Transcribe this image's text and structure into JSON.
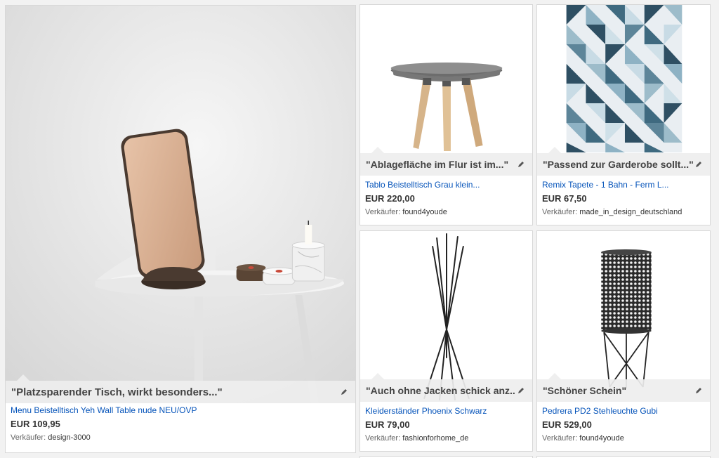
{
  "seller_label": "Verkäufer:",
  "items": [
    {
      "quote": "\"Platzsparender Tisch, wirkt besonders...\"",
      "title": "Menu Beistelltisch Yeh Wall Table nude NEU/OVP",
      "price": "EUR 109,95",
      "seller": "design-3000",
      "image": "wall-table-with-mirror"
    },
    {
      "quote": "\"Ablagefläche im Flur ist im...\"",
      "title": "Tablo Beistelltisch Grau klein...",
      "price": "EUR 220,00",
      "seller": "found4youde",
      "image": "grey-tray-table"
    },
    {
      "quote": "\"Passend zur Garderobe sollt...\"",
      "title": "Remix Tapete - 1 Bahn - Ferm L...",
      "price": "EUR 67,50",
      "seller": "made_in_design_deutschland",
      "image": "geometric-wallpaper"
    },
    {
      "quote": "\"Auch ohne Jacken schick anz...\"",
      "title": "Kleiderständer Phoenix Schwarz",
      "price": "EUR 79,00",
      "seller": "fashionforhome_de",
      "image": "black-coat-stand"
    },
    {
      "quote": "\"Schöner Schein\"",
      "title": "Pedrera PD2 Stehleuchte Gubi",
      "price": "EUR 529,00",
      "seller": "found4youde",
      "image": "perforated-floor-lamp"
    }
  ],
  "colors": {
    "link": "#0654ba",
    "quote_bar": "#eeeeee",
    "border": "#d8d8d8"
  }
}
